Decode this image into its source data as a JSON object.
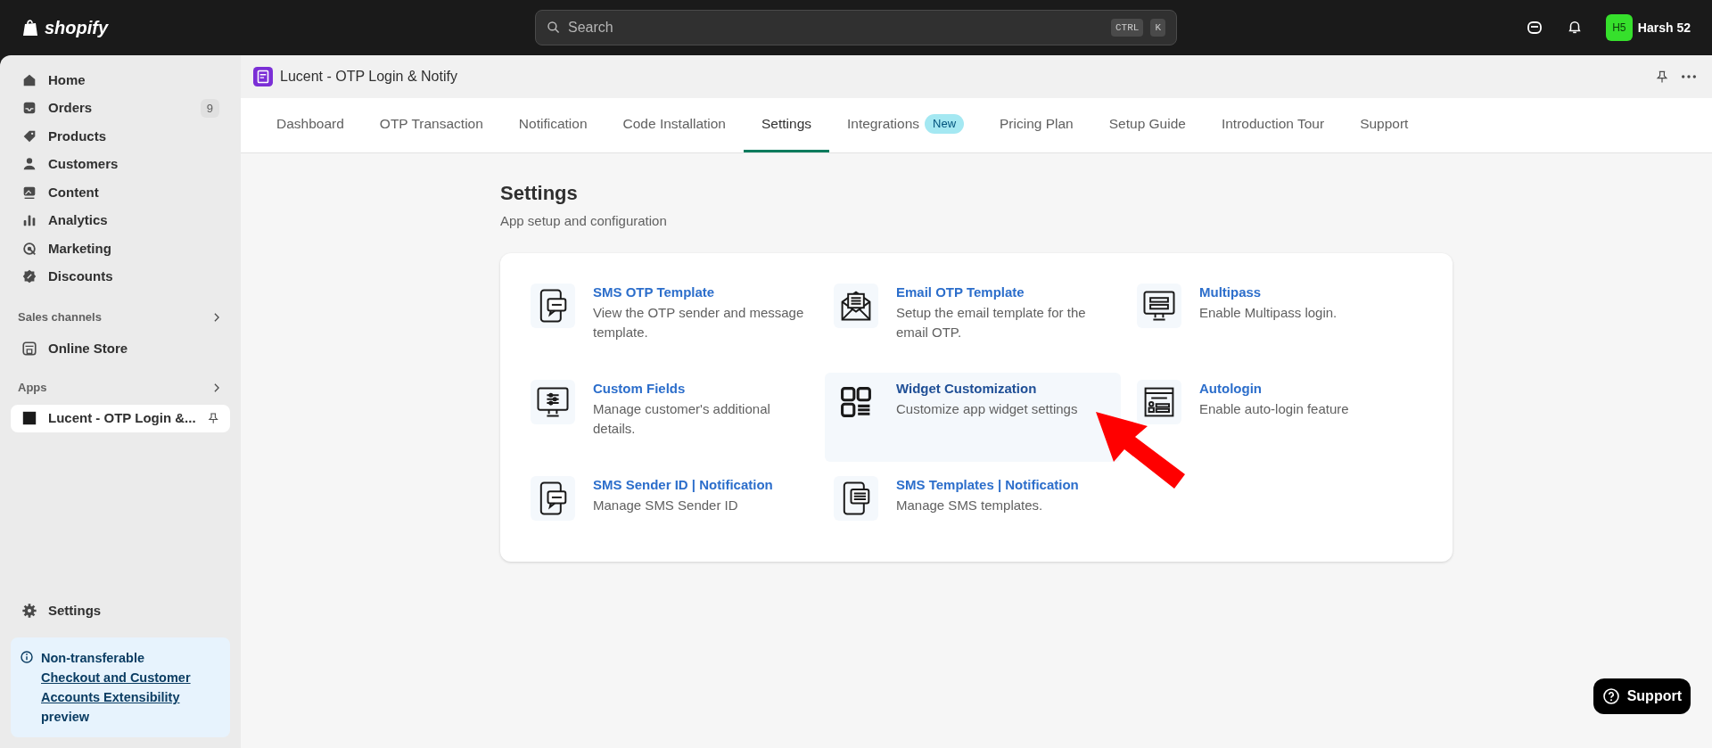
{
  "topbar": {
    "logo": "shopify",
    "search": {
      "placeholder": "Search",
      "keys": [
        "CTRL",
        "K"
      ]
    },
    "user": {
      "initials": "H5",
      "name": "Harsh 52"
    }
  },
  "sidebar": {
    "items": [
      {
        "label": "Home",
        "selected": false
      },
      {
        "label": "Orders",
        "badge": "9",
        "selected": false
      },
      {
        "label": "Products",
        "selected": false
      },
      {
        "label": "Customers",
        "selected": false
      },
      {
        "label": "Content",
        "selected": false
      },
      {
        "label": "Analytics",
        "selected": false
      },
      {
        "label": "Marketing",
        "selected": false
      },
      {
        "label": "Discounts",
        "selected": false
      }
    ],
    "sales_channels": {
      "title": "Sales channels",
      "items": [
        {
          "label": "Online Store",
          "selected": false
        }
      ]
    },
    "apps": {
      "title": "Apps",
      "items": [
        {
          "label": "Lucent - OTP Login &...",
          "pinned": true,
          "selected": true
        }
      ]
    },
    "settings": {
      "label": "Settings",
      "selected": false
    },
    "notice": {
      "title": "Non-transferable",
      "link": "Checkout and Customer Accounts Extensibility",
      "tail": "preview"
    }
  },
  "app_header": {
    "title": "Lucent - OTP Login & Notify"
  },
  "tabs": [
    {
      "label": "Dashboard",
      "selected": false
    },
    {
      "label": "OTP Transaction",
      "selected": false
    },
    {
      "label": "Notification",
      "selected": false
    },
    {
      "label": "Code Installation",
      "selected": false
    },
    {
      "label": "Settings",
      "selected": true
    },
    {
      "label": "Integrations",
      "selected": false,
      "badge": "New"
    },
    {
      "label": "Pricing Plan",
      "selected": false
    },
    {
      "label": "Setup Guide",
      "selected": false
    },
    {
      "label": "Introduction Tour",
      "selected": false
    },
    {
      "label": "Support",
      "selected": false
    }
  ],
  "page": {
    "title": "Settings",
    "subtitle": "App setup and configuration"
  },
  "settings_items": [
    {
      "title": "SMS OTP Template",
      "description": "View the OTP sender and message template.",
      "highlighted": false
    },
    {
      "title": "Email OTP Template",
      "description": "Setup the email template for the email OTP.",
      "highlighted": false
    },
    {
      "title": "Multipass",
      "description": "Enable Multipass login.",
      "highlighted": false
    },
    {
      "title": "Custom Fields",
      "description": "Manage customer's additional details.",
      "highlighted": false
    },
    {
      "title": "Widget Customization",
      "description": "Customize app widget settings",
      "highlighted": true
    },
    {
      "title": "Autologin",
      "description": "Enable auto-login feature",
      "highlighted": false
    },
    {
      "title": "SMS Sender ID | Notification",
      "description": "Manage SMS Sender ID",
      "highlighted": false
    },
    {
      "title": "SMS Templates | Notification",
      "description": "Manage SMS templates.",
      "highlighted": false
    }
  ],
  "support_button": {
    "label": "Support"
  }
}
